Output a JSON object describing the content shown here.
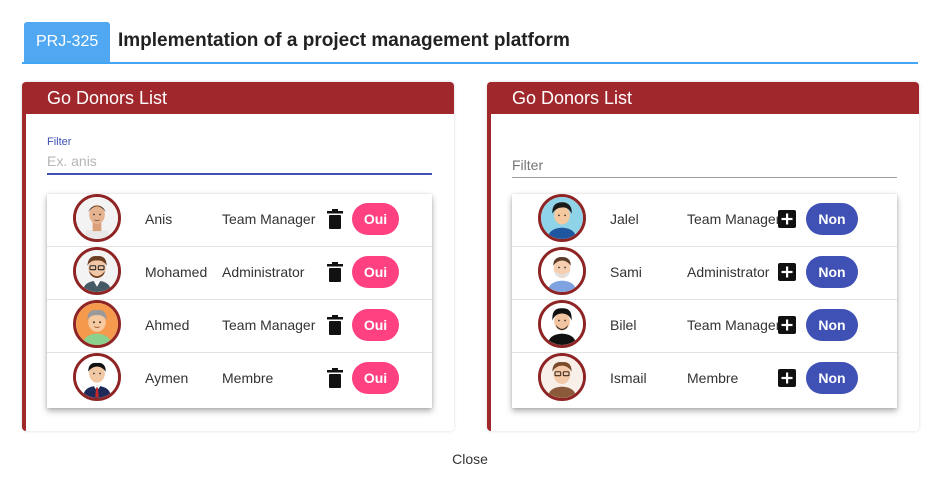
{
  "header": {
    "badge": "PRJ-325",
    "title": "Implementation of a project management platform"
  },
  "left_panel": {
    "title": "Go Donors List",
    "filter_label": "Filter",
    "filter_placeholder": "Ex. anis",
    "filter_value": "",
    "members": [
      {
        "name": "Anis",
        "role": "Team Manager",
        "action": "Oui",
        "icon": "trash-icon"
      },
      {
        "name": "Mohamed",
        "role": "Administrator",
        "action": "Oui",
        "icon": "trash-icon"
      },
      {
        "name": "Ahmed",
        "role": "Team Manager",
        "action": "Oui",
        "icon": "trash-icon"
      },
      {
        "name": "Aymen",
        "role": "Membre",
        "action": "Oui",
        "icon": "trash-icon"
      }
    ]
  },
  "right_panel": {
    "title": "Go Donors List",
    "filter_placeholder": "Filter",
    "filter_value": "",
    "members": [
      {
        "name": "Jalel",
        "role": "Team Manager",
        "action": "Non",
        "icon": "plus-square-icon"
      },
      {
        "name": "Sami",
        "role": "Administrator",
        "action": "Non",
        "icon": "plus-square-icon"
      },
      {
        "name": "Bilel",
        "role": "Team Manager",
        "action": "Non",
        "icon": "plus-square-icon"
      },
      {
        "name": "Ismail",
        "role": "Membre",
        "action": "Non",
        "icon": "plus-square-icon"
      }
    ]
  },
  "footer": {
    "close_label": "Close"
  },
  "colors": {
    "accent": "#42a5f5",
    "panel_header": "#a0282c",
    "oui": "#ff4081",
    "non": "#3f51b5"
  }
}
